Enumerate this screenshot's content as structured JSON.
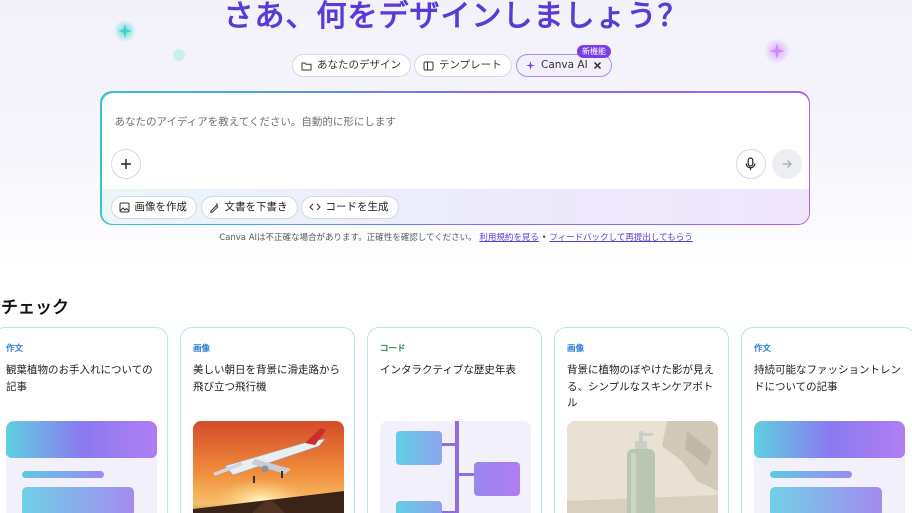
{
  "hero": {
    "headline": "さあ、何をデザインしましょう？"
  },
  "tabs": [
    {
      "label": "あなたのデザイン",
      "icon": "folder-icon"
    },
    {
      "label": "テンプレート",
      "icon": "template-icon"
    },
    {
      "label": "Canva AI",
      "icon": "sparkle-icon",
      "badge": "新機能"
    }
  ],
  "prompt": {
    "placeholder": "あなたのアイディアを教えてください。自動的に形にします",
    "chips": [
      {
        "label": "画像を作成",
        "icon": "image-icon"
      },
      {
        "label": "文書を下書き",
        "icon": "pen-sparkle-icon"
      },
      {
        "label": "コードを生成",
        "icon": "code-icon"
      }
    ]
  },
  "disclaimer": {
    "text": "Canva AIは不正確な場合があります。正確性を確認してください。",
    "link1": "利用規約を見る",
    "separator": "•",
    "link2": "フィードバックして再提出してもらう"
  },
  "section": {
    "title": "チェック"
  },
  "cards": [
    {
      "tag": "作文",
      "tag_color": "#2b7fd6",
      "text": "観葉植物のお手入れについての記事",
      "kind": "doc"
    },
    {
      "tag": "画像",
      "tag_color": "#2b7fd6",
      "text": "美しい朝日を背景に滑走路から飛び立つ飛行機",
      "kind": "plane"
    },
    {
      "tag": "コード",
      "tag_color": "#2a8a3e",
      "text": "インタラクティブな歴史年表",
      "kind": "timeline"
    },
    {
      "tag": "画像",
      "tag_color": "#2b7fd6",
      "text": "背景に植物のぼやけた影が見える、シンプルなスキンケアボトル",
      "kind": "bottle"
    },
    {
      "tag": "作文",
      "tag_color": "#2b7fd6",
      "text": "持続可能なファッショントレンドについての記事",
      "kind": "doc"
    }
  ],
  "colors": {
    "accent": "#5a3bd6",
    "gradient_start": "#35c3d4",
    "gradient_end": "#a866e8"
  }
}
